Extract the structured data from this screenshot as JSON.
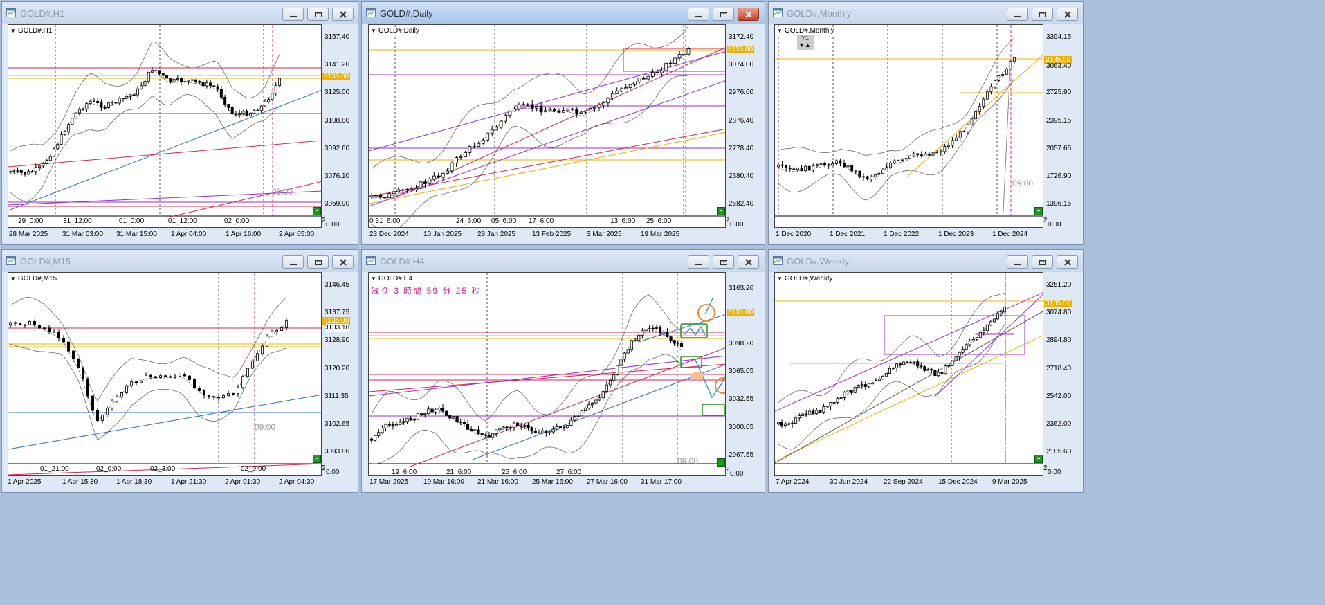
{
  "windows": [
    {
      "id": "h1",
      "title": "GOLD#,H1",
      "label": "GOLD#,H1",
      "active": false,
      "price_labels": [
        "3157.40",
        "3141.20",
        "3125.00",
        "3108.80",
        "3092.60",
        "3076.10",
        "3059.90"
      ],
      "current_price": "3135.00",
      "x_axis": [
        "28 Mar 2025",
        "31 Mar 03:00",
        "31 Mar 15:00",
        "1 Apr 04:00",
        "1 Apr 16:00",
        "2 Apr 05:00"
      ],
      "time_ticks": [
        "29_0:00",
        "31_12:00",
        "01_0:00",
        "01_12:00",
        "02_0:00"
      ],
      "sub_axis": [
        "2",
        "0.00"
      ],
      "time_tag": "09:00"
    },
    {
      "id": "daily",
      "title": "GOLD#,Daily",
      "label": "GOLD#,Daily",
      "active": true,
      "price_labels": [
        "3172.40",
        "3074.00",
        "2976.00",
        "2876.40",
        "2778.40",
        "2680.40",
        "2582.40"
      ],
      "current_price": "3135.00",
      "x_axis": [
        "23 Dec 2024",
        "10 Jan 2025",
        "28 Jan 2025",
        "13 Feb 2025",
        "3 Mar 2025",
        "19 Mar 2025"
      ],
      "time_ticks": [
        "0 31_6:00",
        "24_6:00",
        "05_6:00",
        "17_6:00",
        "13_6:00",
        "25_6:00"
      ],
      "sub_axis": [
        "2",
        "0.00"
      ]
    },
    {
      "id": "monthly",
      "title": "GOLD#,Monthly",
      "label": "GOLD#,Monthly",
      "active": false,
      "price_labels": [
        "3394.15",
        "3063.40",
        "2725.90",
        "2395.15",
        "2057.65",
        "1726.90",
        "1396.15"
      ],
      "current_price": "3135.00",
      "x_axis": [
        "1 Dec 2020",
        "1 Dec 2021",
        "1 Dec 2022",
        "1 Dec 2023",
        "1 Dec 2024"
      ],
      "sub_axis": [
        "2",
        "0.00"
      ],
      "time_tag": "09:00",
      "badge": "Y1"
    },
    {
      "id": "m15",
      "title": "GOLD#,M15",
      "label": "GOLD#,M15",
      "active": false,
      "price_labels": [
        "3146.45",
        "3137.75",
        "3128.90",
        "3120.20",
        "3111.35",
        "3102.65",
        "3093.80"
      ],
      "current_price": "3135.00",
      "secondary_price": "3133.18",
      "x_axis": [
        "1 Apr 2025",
        "1 Apr 15:30",
        "1 Apr 18:30",
        "1 Apr 21:30",
        "2 Apr 01:30",
        "2 Apr 04:30"
      ],
      "time_ticks": [
        "01_21:00",
        "02_0:00",
        "02_3:00",
        "02_9:00"
      ],
      "sub_axis": [
        "2",
        "0.00"
      ],
      "time_tag": "09:00"
    },
    {
      "id": "h4",
      "title": "GOLD#,H4",
      "label": "GOLD#,H4",
      "active": false,
      "countdown": "残り 3 時間 59 分 25 秒",
      "price_labels": [
        "3163.20",
        "3098.20",
        "3065.05",
        "3032.55",
        "3000.05",
        "2967.55"
      ],
      "current_price": "3135.00",
      "x_axis": [
        "17 Mar 2025",
        "19 Mar 16:00",
        "21 Mar 16:00",
        "25 Mar 16:00",
        "27 Mar 16:00",
        "31 Mar 17:00"
      ],
      "time_ticks": [
        "19_6:00",
        "21_6:00",
        "25_6:00",
        "27_6:00"
      ],
      "sub_axis": [
        "2",
        "0.00"
      ],
      "time_tag": "09:00"
    },
    {
      "id": "weekly",
      "title": "GOLD#,Weekly",
      "label": "GOLD#,Weekly",
      "active": false,
      "price_labels": [
        "3251.20",
        "3074.80",
        "2894.80",
        "2718.40",
        "2542.00",
        "2362.00",
        "2185.60"
      ],
      "current_price": "3135.00",
      "x_axis": [
        "7 Apr 2024",
        "30 Jun 2024",
        "22 Sep 2024",
        "15 Dec 2024",
        "9 Mar 2025"
      ],
      "sub_axis": [
        "2",
        "0.00"
      ]
    }
  ],
  "icons": {
    "window": "chart-window-icon",
    "minimize": "minimize-icon",
    "restore": "restore-icon",
    "close": "close-icon"
  },
  "colors": {
    "bull_candle": "#ffffff",
    "bear_candle": "#000000",
    "price_line": "#f0b000",
    "resistance": "#e0204a",
    "trend_blue": "#2a6ad8",
    "channel_purple": "#9b2ad8",
    "orange_line": "#f0a020",
    "time_marker": "#e020b0"
  }
}
